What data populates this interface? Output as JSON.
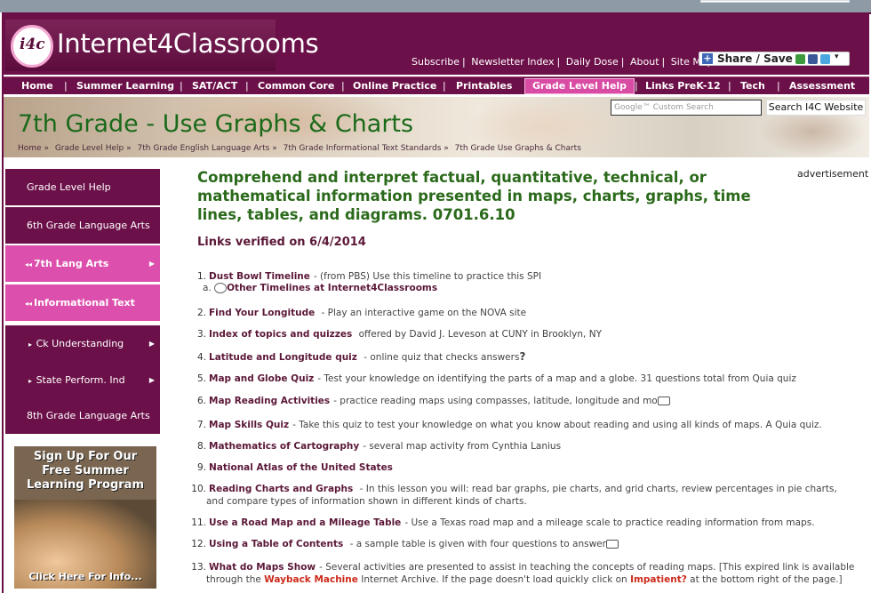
{
  "site": {
    "logo_badge": "i4c",
    "logo_text": "Internet4Classrooms",
    "toplinks": [
      "Subscribe",
      "Newsletter Index",
      "Daily Dose",
      "About",
      "Site Map"
    ],
    "share_label": "Share / Save"
  },
  "nav": [
    "Home",
    "Summer Learning",
    "SAT/ACT",
    "Common Core",
    "Online Practice",
    "Printables",
    "Grade Level Help",
    "Links PreK-12",
    "Tech",
    "Assessment"
  ],
  "banner": {
    "title_main": "7th Grade",
    "title_sub": " - Use Graphs & Charts",
    "search_placeholder": "Google™ Custom Search",
    "search_button": "Search I4C Website",
    "breadcrumb": [
      "Home »",
      "Grade Level Help »",
      "7th Grade English Language Arts »",
      "7th Grade Informational Text Standards »",
      "7th Grade Use Graphs & Charts"
    ]
  },
  "sidebar": {
    "items": [
      {
        "label": "Grade Level Help"
      },
      {
        "label": "6th Grade Language Arts"
      },
      {
        "label": "7th Lang Arts"
      },
      {
        "label": "Informational Text"
      },
      {
        "label": "Ck Understanding"
      },
      {
        "label": "State Perform. Ind"
      },
      {
        "label": "8th Grade Language Arts"
      }
    ],
    "promo_head": "Sign Up For Our Free Summer Learning Program",
    "promo_foot": "Click Here For Info..."
  },
  "main": {
    "heading": "Comprehend and interpret factual, quantitative, technical, or mathematical information presented in maps, charts, graphs, time lines, tables, and diagrams. 0701.6.10",
    "verified": "Links verified on 6/4/2014",
    "advertisement": "advertisement",
    "list": [
      {
        "num": "1.",
        "link": "Dust Bowl Timeline",
        "text": "- (from PBS) Use this timeline to practice this SPI"
      },
      {
        "num": "2.",
        "link": "Find Your Longitude",
        "text": " - Play an interactive game on the NOVA site"
      },
      {
        "num": "3.",
        "link": "Index of topics and quizzes",
        "text": " offered by David J. Leveson at CUNY in Brooklyn, NY"
      },
      {
        "num": "4.",
        "link": "Latitude and Longitude quiz",
        "text": "  - online quiz that checks answers"
      },
      {
        "num": "5.",
        "link": "Map and Globe Quiz",
        "text": "- Test your knowledge on identifying the parts of a map and a globe. 31 questions total from Quia quiz"
      },
      {
        "num": "6.",
        "link": "Map Reading Activities",
        "text": "- practice reading maps using compasses, latitude, longitude and mo"
      },
      {
        "num": "7.",
        "link": "Map Skills Quiz",
        "text": "- Take this quiz to test your knowledge on what you know about reading and using all kinds of maps. A Quia quiz."
      },
      {
        "num": "8.",
        "link": "Mathematics of Cartography",
        "text": "- several map activity from Cynthia Lanius"
      },
      {
        "num": "9.",
        "link": "National Atlas of the United States",
        "text": ""
      },
      {
        "num": "10.",
        "link": "Reading Charts and Graphs",
        "text": " - In this lesson you will: read bar graphs, pie charts, and grid charts, review percentages in pie charts, and compare types of information shown in different kinds of charts."
      },
      {
        "num": "11.",
        "link": "Use a Road Map and a Mileage Table",
        "text": "- Use a Texas road map and a mileage scale to practice reading information from maps."
      },
      {
        "num": "12.",
        "link": "Using a Table of Contents",
        "text": " - a sample table is given with four questions to answer"
      },
      {
        "num": "13.",
        "link": "What do Maps Show",
        "text": "- Several activities are presented to assist in teaching the concepts of reading maps. [This expired link is available through the"
      }
    ],
    "sublist": {
      "letter": "a.",
      "link": "Other Timelines at Internet4Classrooms"
    },
    "item13": {
      "wayback": "Wayback Machine",
      "mid": " Internet Archive. If the page doesn't load quickly click on ",
      "impatient": "Impatient?",
      "end": " at the bottom right of the page.]"
    }
  }
}
